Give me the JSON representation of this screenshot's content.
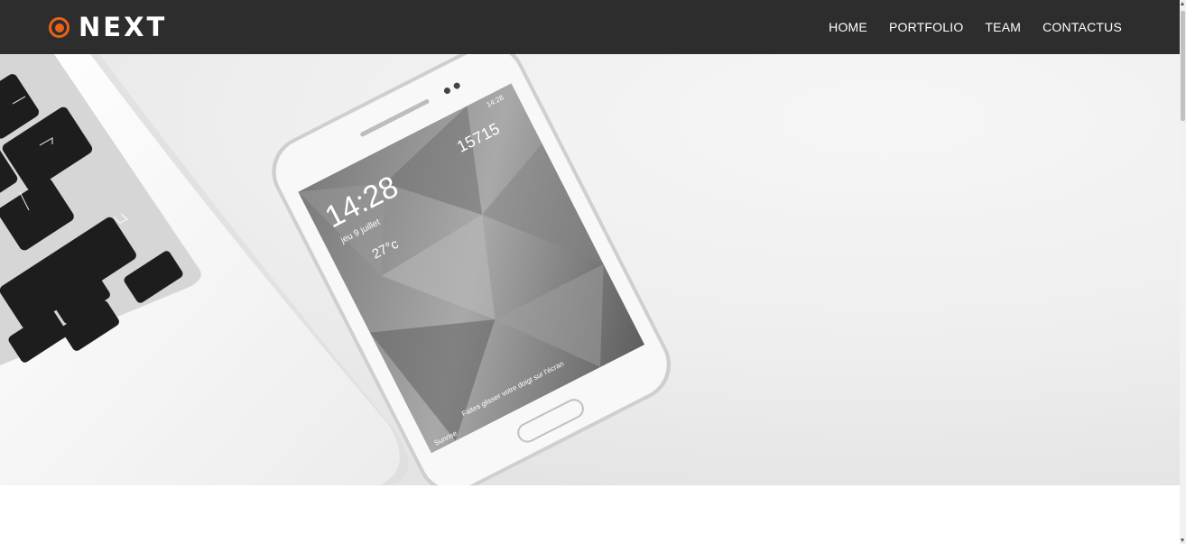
{
  "brand": {
    "name": "NEXT",
    "accent_color": "#e8621a",
    "navbar_color": "#2d2d2d"
  },
  "nav": {
    "items": [
      {
        "label": "HOME"
      },
      {
        "label": "PORTFOLIO"
      },
      {
        "label": "TEAM"
      },
      {
        "label": "CONTACTUS"
      }
    ]
  },
  "hero": {
    "phone_screen": {
      "time": "14:28",
      "date": "jeu 9 juillet",
      "steps": "15715",
      "temperature": "27°c",
      "status_time": "14:28",
      "unlock_hint": "Faites glisser votre doigt sur l'écran",
      "weather_location": "Sunrise"
    }
  }
}
